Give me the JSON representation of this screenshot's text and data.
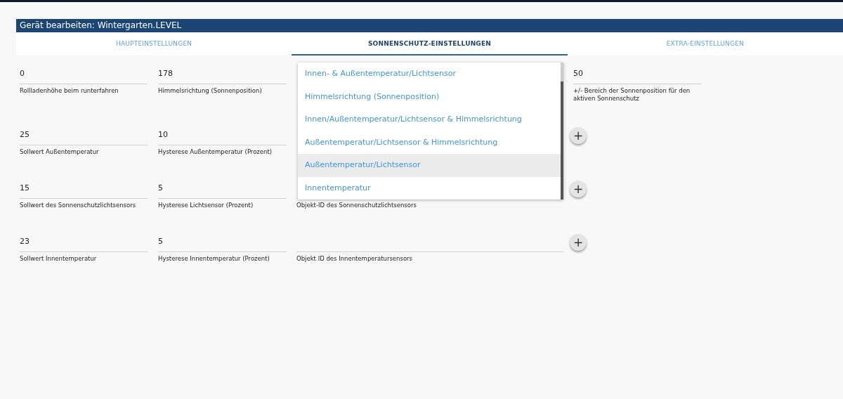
{
  "dialog": {
    "title": "Gerät bearbeiten: Wintergarten.LEVEL"
  },
  "tabs": [
    {
      "label": "HAUPTEINSTELLUNGEN",
      "selected": false
    },
    {
      "label": "SONNENSCHUTZ-EINSTELLUNGEN",
      "selected": true
    },
    {
      "label": "EXTRA-EINSTELLUNGEN",
      "selected": false
    }
  ],
  "rows": [
    {
      "cells": [
        {
          "kind": "field",
          "value": "0",
          "label": "Rollladenhöhe beim runterfahren"
        },
        {
          "kind": "field",
          "value": "178",
          "label": "Himmelsrichtung (Sonnenposition)"
        },
        {
          "kind": "covered"
        },
        {
          "kind": "field",
          "value": "50",
          "label": "+/- Bereich der Sonnenposition für den aktiven Sonnenschutz"
        }
      ]
    },
    {
      "cells": [
        {
          "kind": "field",
          "value": "25",
          "label": "Sollwert Außentemperatur"
        },
        {
          "kind": "field",
          "value": "10",
          "label": "Hysterese Außentemperatur (Prozent)"
        },
        {
          "kind": "covered"
        },
        {
          "kind": "plus",
          "text": "+"
        }
      ]
    },
    {
      "cells": [
        {
          "kind": "field",
          "value": "15",
          "label": "Sollwert des Sonnenschutzlichtsensors"
        },
        {
          "kind": "field",
          "value": "5",
          "label": "Hysterese Lichtsensor (Prozent)"
        },
        {
          "kind": "field",
          "label": "Objekt-ID des Sonnenschutzlichtsensors"
        },
        {
          "kind": "plus",
          "text": "+"
        }
      ]
    },
    {
      "cells": [
        {
          "kind": "field",
          "value": "23",
          "label": "Sollwert Innentemperatur"
        },
        {
          "kind": "field",
          "value": "5",
          "label": "Hysterese Innentemperatur (Prozent)"
        },
        {
          "kind": "field",
          "label": "Objekt ID des Innentemperatursensors"
        },
        {
          "kind": "plus",
          "text": "+"
        }
      ]
    }
  ],
  "dropdown": {
    "options": [
      {
        "label": "Innen- & Außentemperatur/Lichtsensor",
        "selected": false
      },
      {
        "label": "Himmelsrichtung (Sonnenposition)",
        "selected": false
      },
      {
        "label": "Innen/Außentemperatur/Lichtsensor & Himmelsrichtung",
        "selected": false
      },
      {
        "label": "Außentemperatur/Lichtsensor & Himmelsrichtung",
        "selected": false
      },
      {
        "label": "Außentemperatur/Lichtsensor",
        "selected": true
      },
      {
        "label": "Innentemperatur",
        "selected": false
      }
    ]
  }
}
